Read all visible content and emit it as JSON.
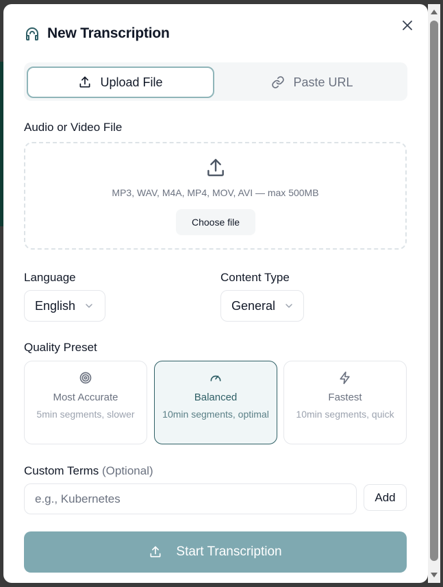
{
  "dialog": {
    "title": "New Transcription",
    "close_icon": "close-icon",
    "header_icon": "headphones-icon"
  },
  "tabs": [
    {
      "label": "Upload File",
      "icon": "upload-icon",
      "active": true
    },
    {
      "label": "Paste URL",
      "icon": "link-icon",
      "active": false
    }
  ],
  "file": {
    "label": "Audio or Video File",
    "formats": "MP3, WAV, M4A, MP4, MOV, AVI — max 500MB",
    "choose_label": "Choose file"
  },
  "language": {
    "label": "Language",
    "value": "English"
  },
  "content_type": {
    "label": "Content Type",
    "value": "General"
  },
  "quality": {
    "label": "Quality Preset",
    "presets": [
      {
        "name": "Most Accurate",
        "desc": "5min segments, slower",
        "icon": "target-icon",
        "selected": false
      },
      {
        "name": "Balanced",
        "desc": "10min segments, optimal",
        "icon": "gauge-icon",
        "selected": true
      },
      {
        "name": "Fastest",
        "desc": "10min segments, quick",
        "icon": "lightning-icon",
        "selected": false
      }
    ]
  },
  "custom_terms": {
    "label": "Custom Terms",
    "optional": "(Optional)",
    "placeholder": "e.g., Kubernetes",
    "add_label": "Add"
  },
  "submit": {
    "label": "Start Transcription"
  },
  "colors": {
    "accent": "#2f6066",
    "button_disabled": "#7fa9b1",
    "tab_border": "#8fb5b9"
  }
}
